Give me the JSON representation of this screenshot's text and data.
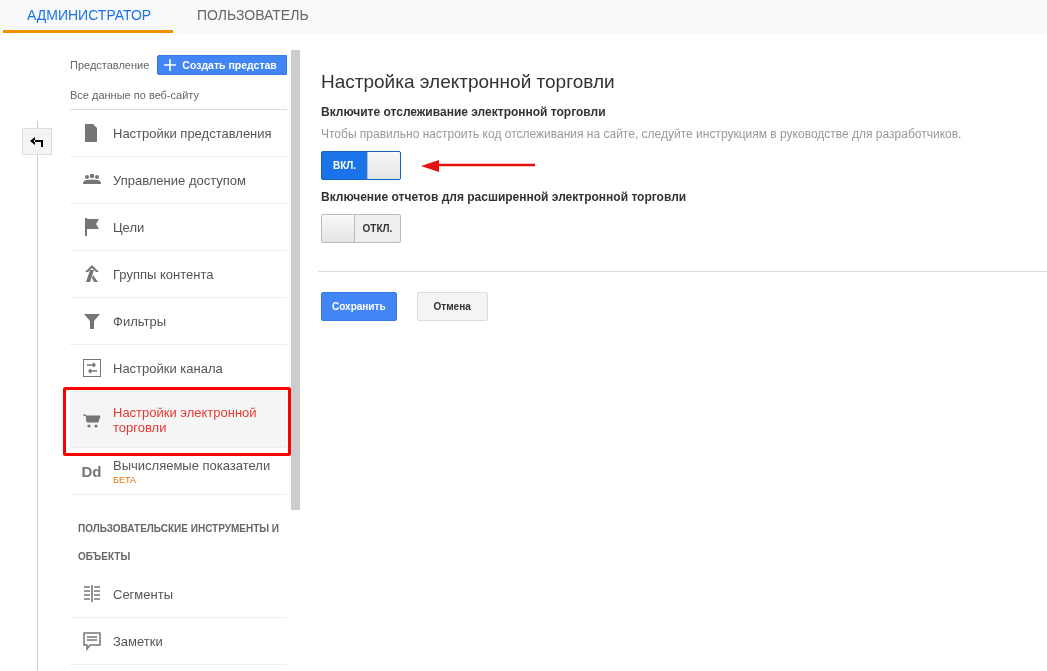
{
  "tabs": [
    {
      "label": "АДМИНИСТРАТОР",
      "selected": true
    },
    {
      "label": "ПОЛЬЗОВАТЕЛЬ",
      "selected": false
    }
  ],
  "sidebar": {
    "view_label": "Представление",
    "create_button": "Создать представ",
    "view_name": "Все данные по веб-сайту",
    "items": [
      {
        "label": "Настройки представления",
        "selected": false
      },
      {
        "label": "Управление доступом",
        "selected": false
      },
      {
        "label": "Цели",
        "selected": false
      },
      {
        "label": "Группы контента",
        "selected": false
      },
      {
        "label": "Фильтры",
        "selected": false
      },
      {
        "label": "Настройки канала",
        "selected": false
      },
      {
        "label": "Настройки электронной торговли",
        "selected": true
      },
      {
        "label": "Вычисляемые показатели",
        "selected": false,
        "icon_text": "Dd",
        "badge": "БЕТА"
      }
    ],
    "section_heading": [
      "ПОЛЬЗОВАТЕЛЬСКИЕ ИНСТРУМЕНТЫ И",
      "ОБЪЕКТЫ"
    ],
    "tool_items": [
      {
        "label": "Сегменты",
        "selected": false
      },
      {
        "label": "Заметки",
        "selected": false
      }
    ]
  },
  "main": {
    "title": "Настройка электронной торговли",
    "settings": [
      {
        "label": "Включите отслеживание электронной торговли",
        "hint": "Чтобы правильно настроить код отслеживания на сайте, следуйте инструкциям в руководстве для разработчиков.",
        "on": true,
        "toggle_text": "ВКЛ.",
        "annotated": true
      },
      {
        "label": "Включение отчетов для расширенной электронной торговли",
        "on": false,
        "toggle_text": "ОТКЛ.",
        "annotated": false
      }
    ],
    "buttons": [
      {
        "label": "Сохранить",
        "kind": "primary"
      },
      {
        "label": "Отмена",
        "kind": "secondary"
      }
    ]
  }
}
